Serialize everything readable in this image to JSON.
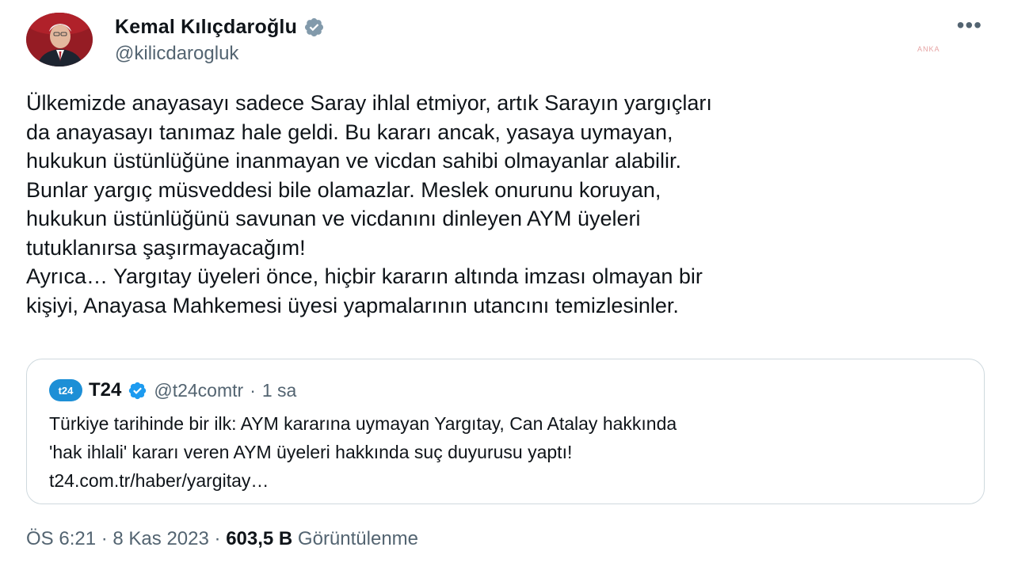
{
  "author": {
    "name": "Kemal Kılıçdaroğlu",
    "handle": "@kilicdarogluk",
    "verified_icon": "verified-badge",
    "avatar_bg": "#b8c4ce"
  },
  "more_label": "•••",
  "watermark": "ANKA",
  "body": {
    "lines": [
      "Ülkemizde anayasayı sadece Saray ihlal etmiyor, artık Sarayın yargıçları",
      "da anayasayı tanımaz hale geldi. Bu kararı ancak, yasaya uymayan,",
      "hukukun üstünlüğüne inanmayan ve vicdan sahibi olmayanlar alabilir.",
      "Bunlar yargıç müsveddesi bile olamazlar. Meslek onurunu koruyan,",
      "hukukun üstünlüğünü savunan ve vicdanını dinleyen AYM üyeleri",
      "tutuklanırsa şaşırmayacağım!",
      "Ayrıca… Yargıtay üyeleri önce, hiçbir kararın altında imzası olmayan bir",
      "kişiyi, Anayasa Mahkemesi üyesi yapmalarının utancını temizlesinler."
    ]
  },
  "quote": {
    "logo_text": "t24",
    "name": "T24",
    "handle": "@t24comtr",
    "separator": "·",
    "time": "1 sa",
    "lines": [
      "Türkiye tarihinde bir ilk: AYM kararına uymayan Yargıtay, Can Atalay hakkında",
      "'hak ihlali' kararı veren AYM üyeleri hakkında suç duyurusu yaptı!",
      "t24.com.tr/haber/yargitay…"
    ]
  },
  "meta": {
    "time": "ÖS 6:21",
    "separator": "·",
    "date": "8 Kas 2023",
    "views_count": "603,5 B",
    "views_label": "Görüntülenme"
  },
  "colors": {
    "verified_blue": "#1d9bf0",
    "verified_gray": "#829aab",
    "text_primary": "#0f1419",
    "text_secondary": "#536471",
    "border": "#cfd9de"
  }
}
